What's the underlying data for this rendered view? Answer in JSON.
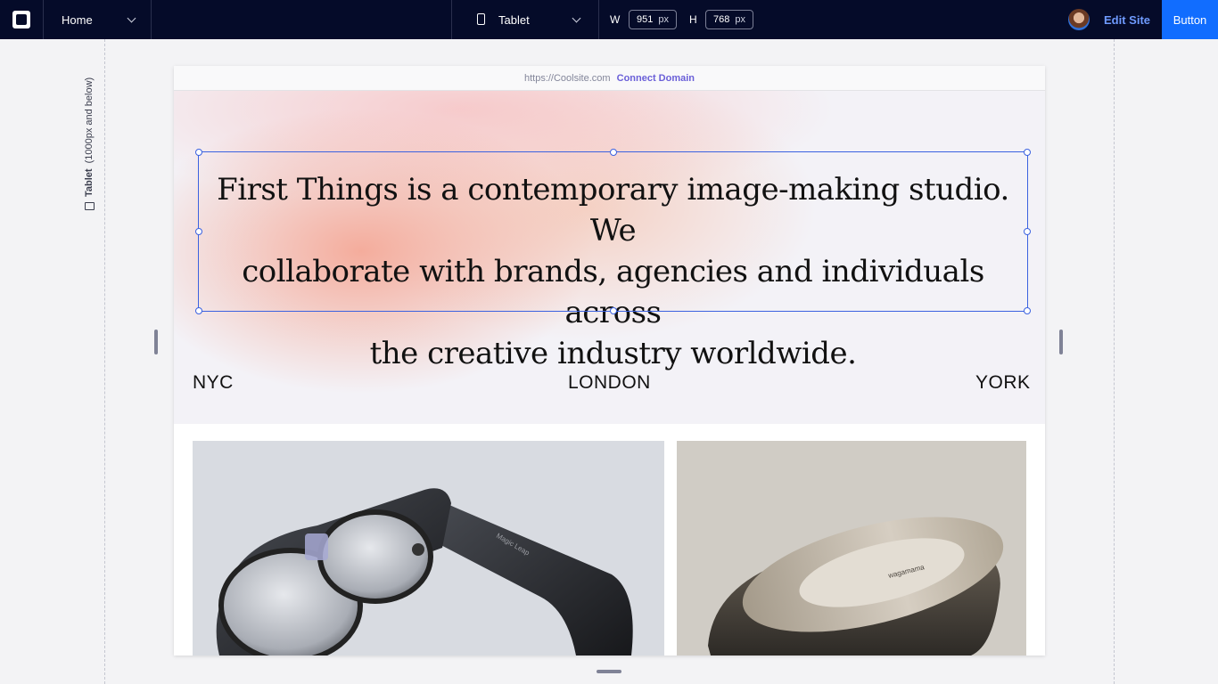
{
  "topbar": {
    "page_selector": "Home",
    "device_selector": "Tablet",
    "width_label": "W",
    "width_value": "951",
    "width_unit": "px",
    "height_label": "H",
    "height_value": "768",
    "height_unit": "px",
    "edit_site": "Edit Site",
    "button": "Button"
  },
  "canvas": {
    "breakpoint_name": "Tablet",
    "breakpoint_range": "(1000px and below)"
  },
  "site": {
    "url": "https://Coolsite.com",
    "connect_domain": "Connect Domain",
    "hero_lines": [
      "First Things is a contemporary image-making studio. We",
      "collaborate with brands, agencies and individuals across",
      "the creative industry worldwide."
    ],
    "cities": [
      "NYC",
      "LONDON",
      "YORK"
    ],
    "product_text_left": "Magic Leap",
    "product_text_right": "wagamama"
  },
  "colors": {
    "topbar_bg": "#050b29",
    "accent": "#116dff",
    "edit_site": "#6f9bff",
    "selection": "#3b62e0",
    "connect_domain": "#6a5fd8"
  }
}
